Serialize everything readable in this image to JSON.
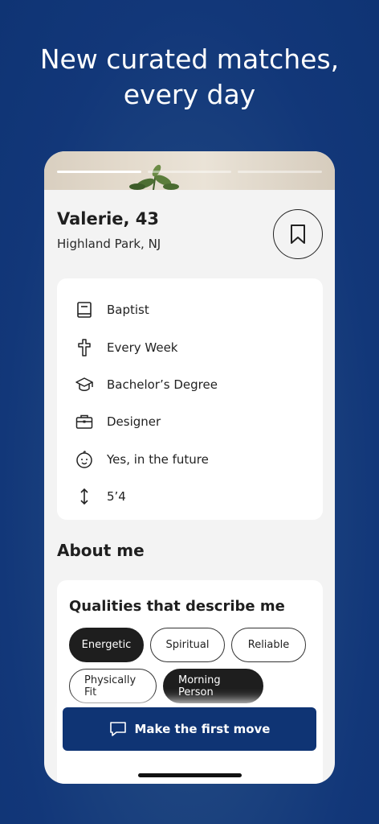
{
  "headline": "New curated matches, every day",
  "profile": {
    "name": "Valerie, 43",
    "location": "Highland Park, NJ"
  },
  "details": [
    {
      "icon": "book-icon",
      "label": "Baptist"
    },
    {
      "icon": "cross-icon",
      "label": "Every Week"
    },
    {
      "icon": "graduation-cap-icon",
      "label": "Bachelor’s Degree"
    },
    {
      "icon": "briefcase-icon",
      "label": "Designer"
    },
    {
      "icon": "baby-icon",
      "label": "Yes, in the future"
    },
    {
      "icon": "height-arrows-icon",
      "label": "5’4"
    }
  ],
  "about": {
    "heading": "About me",
    "qualities_heading": "Qualities that describe me",
    "chips": [
      {
        "label": "Energetic",
        "selected": true
      },
      {
        "label": "Spiritual",
        "selected": false
      },
      {
        "label": "Reliable",
        "selected": false
      },
      {
        "label": "Physically Fit",
        "selected": false
      },
      {
        "label": "Morning Person",
        "selected": true
      }
    ]
  },
  "cta": {
    "label": "Make the first move",
    "icon": "chat-bubble-icon"
  },
  "progress": {
    "count": 3,
    "active_index": 0
  },
  "colors": {
    "background": "#123779",
    "primary": "#0f3474",
    "chip_selected": "#1e1e1e"
  }
}
